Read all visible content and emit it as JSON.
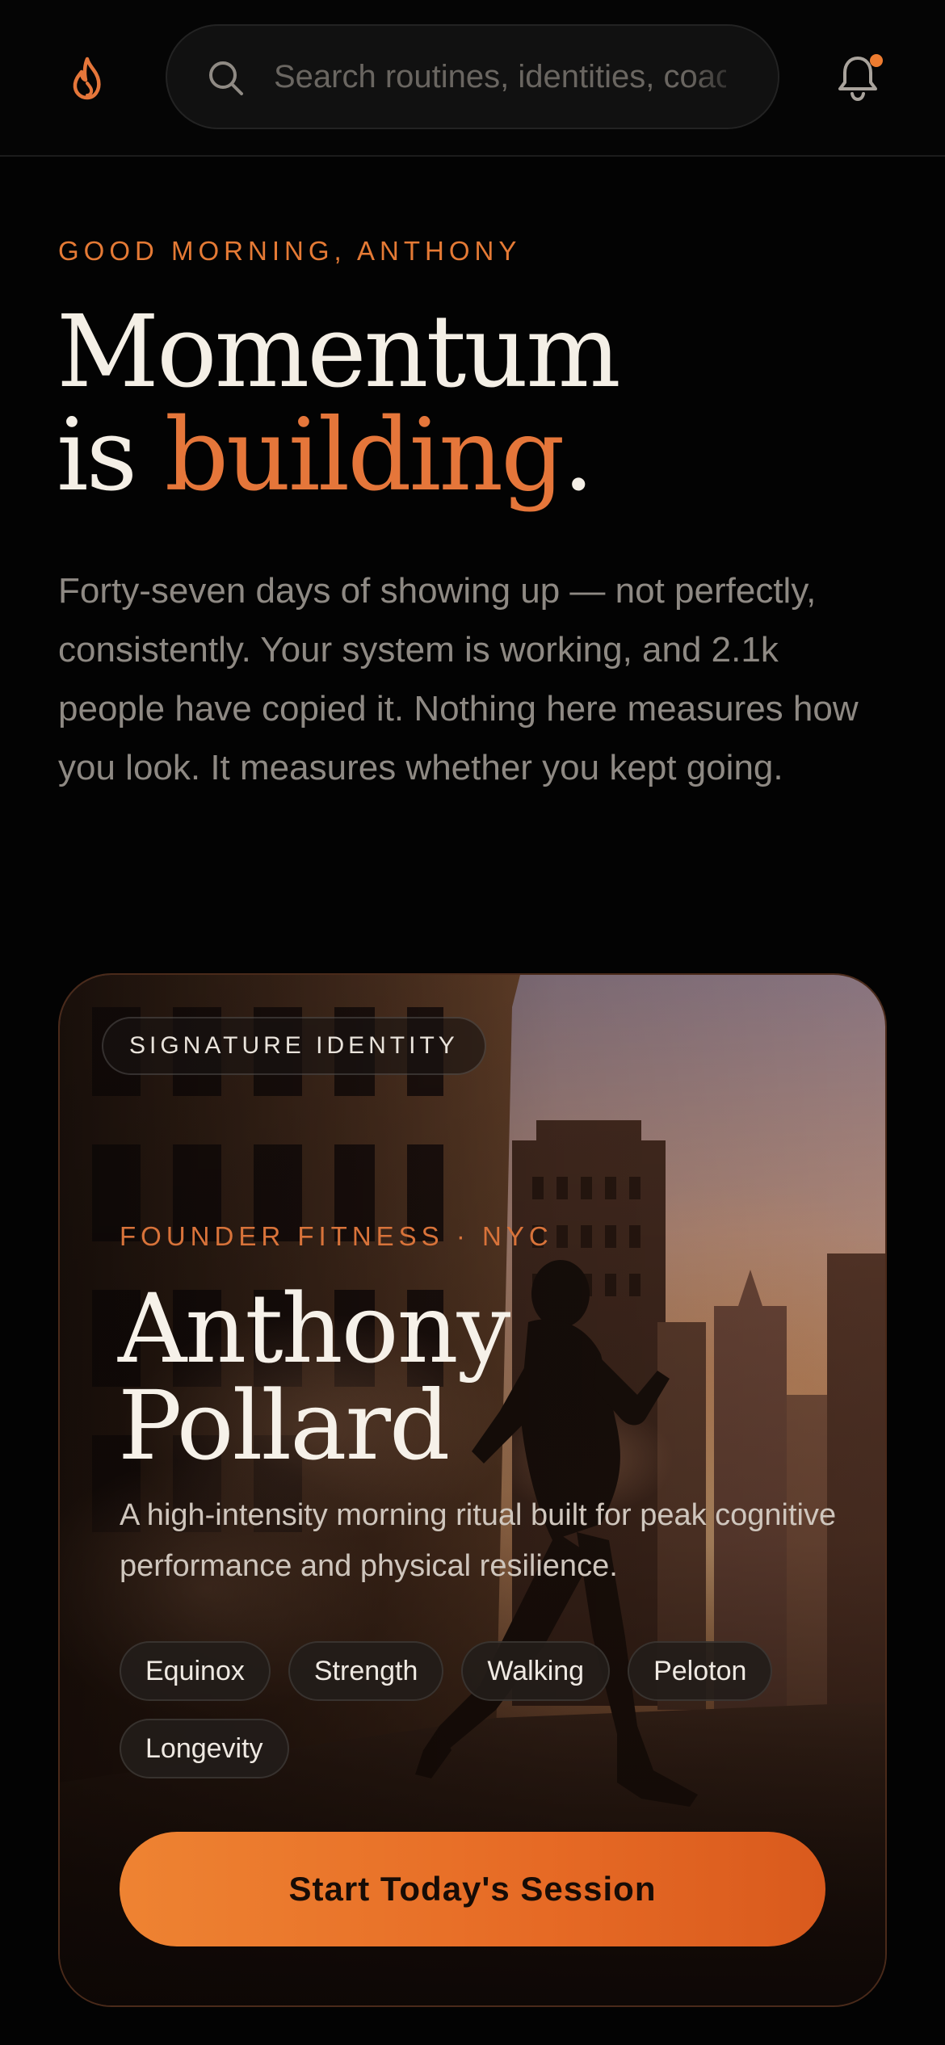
{
  "header": {
    "logo_icon": "flame-icon",
    "search": {
      "placeholder": "Search routines, identities, coaches",
      "value": ""
    },
    "notifications_icon": "bell-icon",
    "notification_badge_color": "#ee7c30"
  },
  "hero": {
    "greeting": "GOOD MORNING, ANTHONY",
    "headline_line1": "Momentum",
    "headline_is": "is ",
    "headline_accent": "building",
    "headline_period": ".",
    "intro": "Forty-seven days of showing up — not perfectly, consistently. Your system is working, and 2.1k people have copied it. Nothing here measures how you look. It measures whether you kept going."
  },
  "card": {
    "badge": "SIGNATURE IDENTITY",
    "kicker": "FOUNDER FITNESS · NYC",
    "name_first": "Anthony",
    "name_last": "Pollard",
    "description": "A high-intensity morning ritual built for peak cognitive performance and physical resilience.",
    "tags": [
      "Equinox",
      "Strength",
      "Walking",
      "Peloton",
      "Longevity"
    ],
    "cta_label": "Start Today's Session"
  },
  "colors": {
    "accent": "#e5763a",
    "background": "#030303",
    "text_primary": "#f4efe6",
    "text_muted": "#8e8983"
  }
}
